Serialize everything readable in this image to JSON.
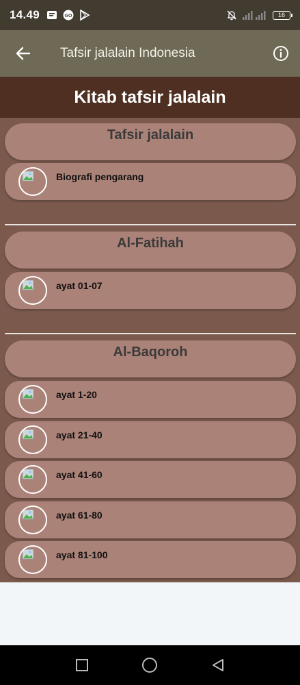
{
  "status_bar": {
    "time": "14.49",
    "battery": "16"
  },
  "app_bar": {
    "title": "Tafsir jalalain Indonesia"
  },
  "header": {
    "title": "Kitab tafsir jalalain"
  },
  "sections": [
    {
      "title": "Tafsir jalalain",
      "items": [
        "Biografi pengarang"
      ]
    },
    {
      "title": "Al-Fatihah",
      "items": [
        "ayat 01-07"
      ]
    },
    {
      "title": "Al-Baqoroh",
      "items": [
        "ayat 1-20",
        "ayat 21-40",
        "ayat 41-60",
        "ayat 61-80",
        "ayat 81-100"
      ]
    }
  ],
  "colors": {
    "status_bar": "#423c30",
    "app_bar": "#6f6a55",
    "header_band": "#4e2f22",
    "content_bg": "#7b5a4d",
    "card": "#ab8277"
  }
}
